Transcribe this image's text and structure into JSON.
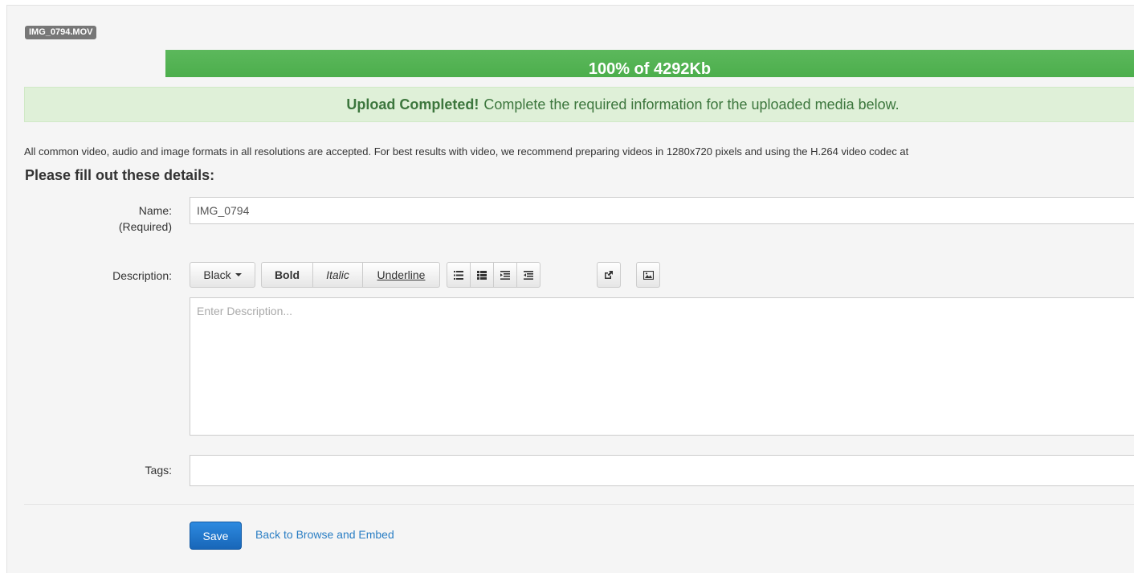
{
  "file": {
    "badge": "IMG_0794.MOV"
  },
  "progress": {
    "percent": 100,
    "label": "100% of 4292Kb",
    "fill_color": "#5cb85c"
  },
  "alert": {
    "strong": "Upload Completed!",
    "message": "Complete the required information for the uploaded media below."
  },
  "info_text": "All common video, audio and image formats in all resolutions are accepted.  For best results with video, we recommend preparing videos in 1280x720 pixels and using the H.264 video codec at",
  "form": {
    "heading": "Please fill out these details:",
    "name_label": "Name:",
    "name_required": "(Required)",
    "name_value": "IMG_0794",
    "description_label": "Description:",
    "description_placeholder": "Enter Description...",
    "tags_label": "Tags:",
    "tags_value": ""
  },
  "toolbar": {
    "color_label": "Black",
    "bold_label": "Bold",
    "italic_label": "Italic",
    "underline_label": "Underline",
    "icons": [
      "unordered-list-icon",
      "ordered-list-icon",
      "outdent-icon",
      "indent-icon",
      "link-icon",
      "image-icon"
    ]
  },
  "actions": {
    "save_label": "Save",
    "back_label": "Back to Browse and Embed",
    "save_color": "#1a6fc9",
    "link_color": "#2a7ec4"
  }
}
